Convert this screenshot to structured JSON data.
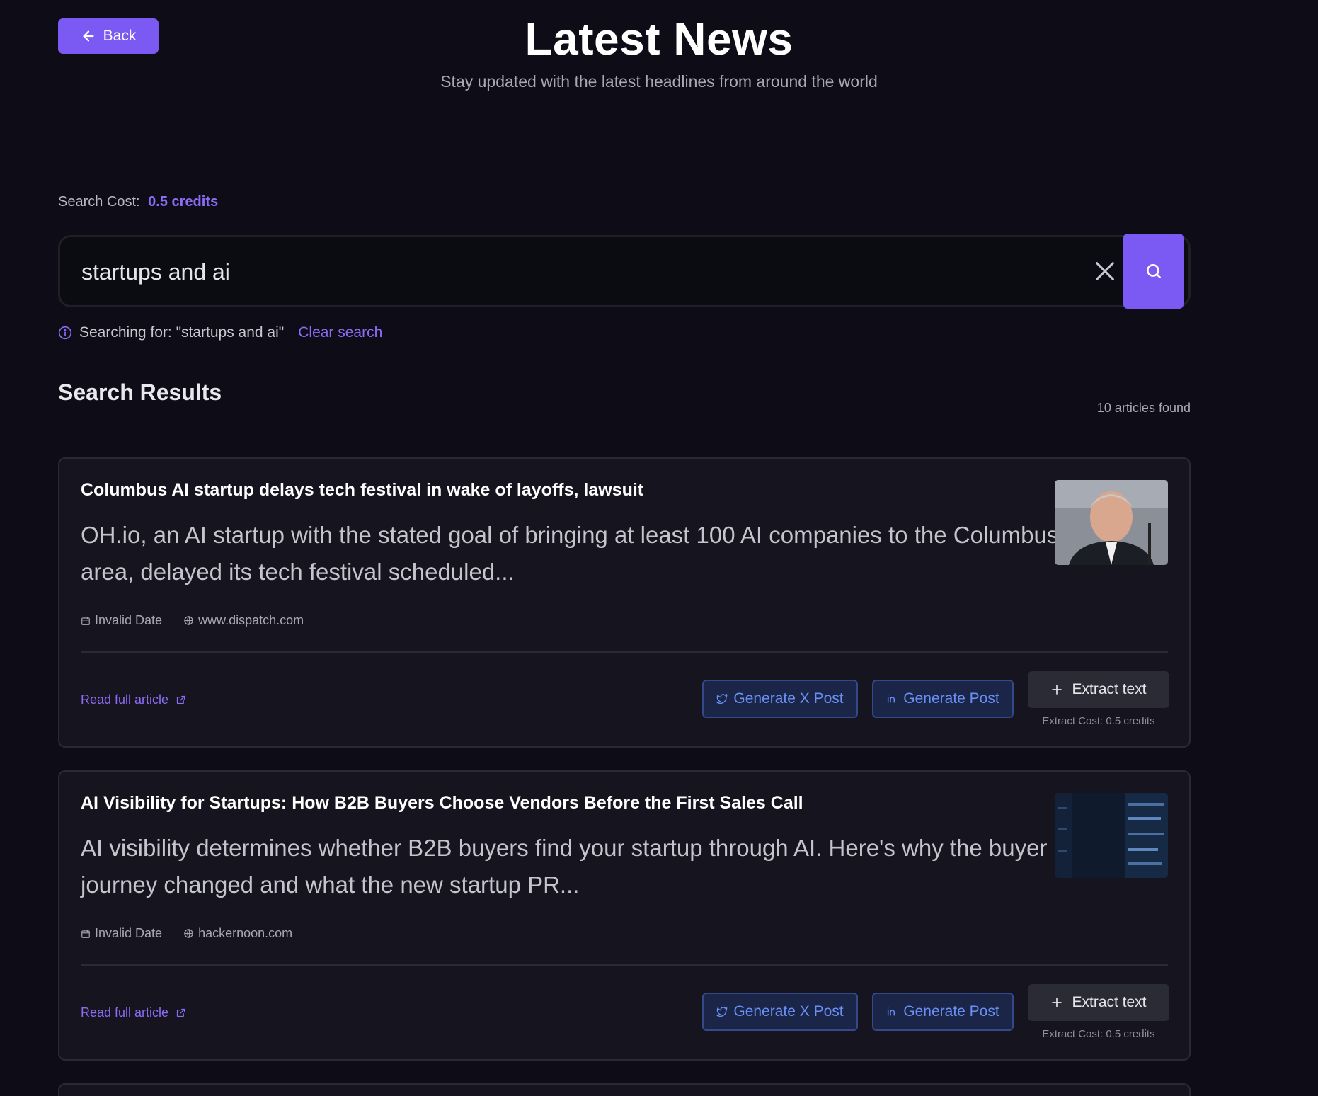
{
  "header": {
    "back_label": "Back",
    "title": "Latest News",
    "subtitle": "Stay updated with the latest headlines from around the world"
  },
  "search": {
    "cost_label": "Search Cost:",
    "cost_value": "0.5 credits",
    "query": "startups and ai",
    "searching_for": "Searching for: \"startups and ai\"",
    "clear_label": "Clear search"
  },
  "results": {
    "title": "Search Results",
    "count": "10 articles found",
    "articles": [
      {
        "title": "Columbus AI startup delays tech festival in wake of layoffs, lawsuit",
        "description": "OH.io, an AI startup with the stated goal of bringing at least 100 AI companies to the Columbus area, delayed its tech festival scheduled...",
        "date": "Invalid Date",
        "source": "www.dispatch.com",
        "read_label": "Read full article",
        "gen_x_label": "Generate X Post",
        "gen_li_label": "Generate Post",
        "extract_label": "Extract text",
        "extract_cost": "Extract Cost: 0.5 credits"
      },
      {
        "title": "AI Visibility for Startups: How B2B Buyers Choose Vendors Before the First Sales Call",
        "description": "AI visibility determines whether B2B buyers find your startup through AI. Here's why the buyer journey changed and what the new startup PR...",
        "date": "Invalid Date",
        "source": "hackernoon.com",
        "read_label": "Read full article",
        "gen_x_label": "Generate X Post",
        "gen_li_label": "Generate Post",
        "extract_label": "Extract text",
        "extract_cost": "Extract Cost: 0.5 credits"
      }
    ]
  },
  "colors": {
    "accent": "#7a5af2",
    "link": "#8b6cf5",
    "background": "#0e0d17",
    "card": "#15141f",
    "gen_button_text": "#6a8ff5"
  },
  "icons": {
    "back": "arrow-left-icon",
    "clear": "close-icon",
    "search": "search-icon",
    "info": "info-icon",
    "date": "calendar-icon",
    "source": "globe-icon",
    "external": "external-link-icon",
    "x_post": "twitter-bird-icon",
    "linkedin": "linkedin-icon",
    "extract": "plus-icon"
  }
}
